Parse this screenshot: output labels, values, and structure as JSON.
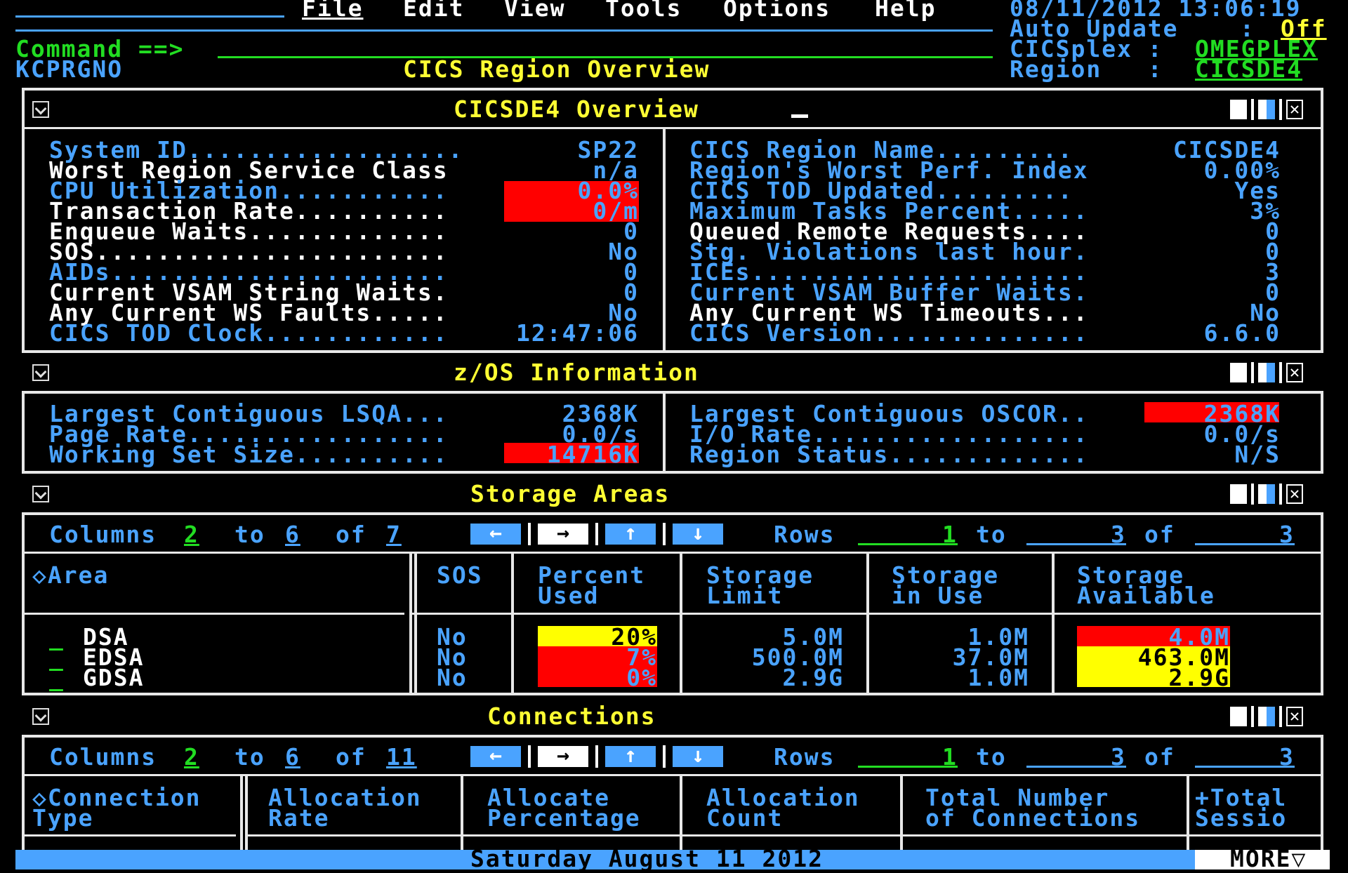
{
  "menu": [
    "File",
    "Edit",
    "View",
    "Tools",
    "Options",
    "Help"
  ],
  "header": {
    "datetime": "08/11/2012 13:06:19",
    "auto_update_label": "Auto Update    :",
    "auto_update_value": "Off",
    "cicsplex_label": "CICSplex :",
    "cicsplex_value": "OMEGPLEX",
    "region_label": "Region   :",
    "region_value": "CICSDE4",
    "command_label": "Command ==>",
    "screen_id": "KCPRGNO",
    "page_title": "CICS Region Overview"
  },
  "overview": {
    "title": "CICSDE4 Overview",
    "left": [
      {
        "label": "System ID..................",
        "value": "SP22",
        "color": "c",
        "alert": ""
      },
      {
        "label": "Worst Region Service Class",
        "value": "n/a",
        "color": "w",
        "alert": ""
      },
      {
        "label": "CPU Utilization...........",
        "value": "0.0%",
        "color": "c",
        "alert": "red"
      },
      {
        "label": "Transaction Rate..........",
        "value": "0/m",
        "color": "w",
        "alert": "red"
      },
      {
        "label": "Enqueue Waits.............",
        "value": "0",
        "color": "w",
        "alert": ""
      },
      {
        "label": "SOS.......................",
        "value": "No",
        "color": "w",
        "alert": ""
      },
      {
        "label": "AIDs......................",
        "value": "0",
        "color": "c",
        "alert": ""
      },
      {
        "label": "Current VSAM String Waits.",
        "value": "0",
        "color": "w",
        "alert": ""
      },
      {
        "label": "Any Current WS Faults.....",
        "value": "No",
        "color": "w",
        "alert": ""
      },
      {
        "label": "CICS TOD Clock............",
        "value": "12:47:06",
        "color": "c",
        "alert": ""
      }
    ],
    "right": [
      {
        "label": "CICS Region Name.........",
        "value": "CICSDE4",
        "color": "c"
      },
      {
        "label": "Region's Worst Perf. Index",
        "value": "0.00%",
        "color": "c"
      },
      {
        "label": "CICS TOD Updated.........",
        "value": "Yes",
        "color": "c"
      },
      {
        "label": "Maximum Tasks Percent.....",
        "value": "3%",
        "color": "c"
      },
      {
        "label": "Queued Remote Requests....",
        "value": "0",
        "color": "w"
      },
      {
        "label": "Stg. Violations last hour.",
        "value": "0",
        "color": "c"
      },
      {
        "label": "ICEs......................",
        "value": "3",
        "color": "c"
      },
      {
        "label": "Current VSAM Buffer Waits.",
        "value": "0",
        "color": "c"
      },
      {
        "label": "Any Current WS Timeouts...",
        "value": "No",
        "color": "w"
      },
      {
        "label": "CICS Version..............",
        "value": "6.6.0",
        "color": "c"
      }
    ]
  },
  "zos": {
    "title": "z/OS Information",
    "left": [
      {
        "label": "Largest Contiguous LSQA...",
        "value": "2368K",
        "alert": ""
      },
      {
        "label": "Page Rate.................",
        "value": "0.0/s",
        "alert": ""
      },
      {
        "label": "Working Set Size..........",
        "value": "14716K",
        "alert": "red"
      }
    ],
    "right": [
      {
        "label": "Largest Contiguous OSCOR..",
        "value": "2368K",
        "alert": "red"
      },
      {
        "label": "I/O Rate..................",
        "value": "0.0/s",
        "alert": ""
      },
      {
        "label": "Region Status.............",
        "value": "N/S",
        "alert": ""
      }
    ]
  },
  "storage": {
    "title": "Storage Areas",
    "nav": {
      "columns": "Columns",
      "col_from": "2",
      "to": "to",
      "col_to": "6",
      "of": "of",
      "col_total": "7",
      "rows": "Rows",
      "row_from": "1",
      "row_to": "3",
      "row_total": "3"
    },
    "headers": [
      [
        "◇Area",
        ""
      ],
      [
        "SOS",
        ""
      ],
      [
        "Percent",
        "Used"
      ],
      [
        "Storage",
        "Limit"
      ],
      [
        "Storage",
        "in Use"
      ],
      [
        "Storage",
        "Available"
      ]
    ],
    "rows": [
      {
        "sel": "_",
        "area": "DSA",
        "sos": "No",
        "pct": "20%",
        "pct_alert": "yellow",
        "limit": "5.0M",
        "inuse": "1.0M",
        "avail": "4.0M",
        "avail_alert": "red"
      },
      {
        "sel": "_",
        "area": "EDSA",
        "sos": "No",
        "pct": "7%",
        "pct_alert": "red",
        "limit": "500.0M",
        "inuse": "37.0M",
        "avail": "463.0M",
        "avail_alert": "yellow"
      },
      {
        "sel": "_",
        "area": "GDSA",
        "sos": "No",
        "pct": "0%",
        "pct_alert": "red",
        "limit": "2.9G",
        "inuse": "1.0M",
        "avail": "2.9G",
        "avail_alert": "yellow"
      }
    ]
  },
  "connections": {
    "title": "Connections",
    "nav": {
      "columns": "Columns",
      "col_from": "2",
      "to": "to",
      "col_to": "6",
      "of": "of",
      "col_total": "11",
      "rows": "Rows",
      "row_from": "1",
      "row_to": "3",
      "row_total": "3"
    },
    "headers": [
      [
        "◇Connection",
        "Type"
      ],
      [
        "Allocation",
        "Rate"
      ],
      [
        "Allocate",
        "Percentage"
      ],
      [
        "Allocation",
        "Count"
      ],
      [
        "Total Number",
        "of Connections"
      ],
      [
        "+Total",
        "Sessio"
      ]
    ]
  },
  "status_bar": {
    "date": "Saturday August 11 2012",
    "more": "MORE▽"
  },
  "colors": {
    "cyan": "#4aa3ff",
    "green": "#22dd22",
    "yellow": "#ffff33",
    "alert_red": "#ff0000",
    "alert_yellow": "#ffff00",
    "status_bar": "#4aa3ff"
  }
}
